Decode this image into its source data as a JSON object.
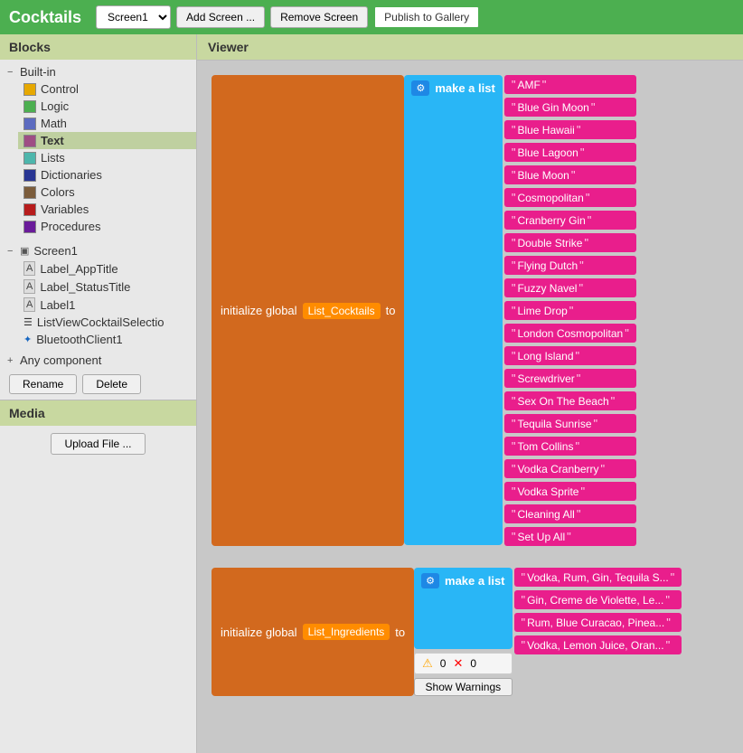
{
  "app": {
    "title": "Cocktails"
  },
  "topbar": {
    "screen_select": "Screen1",
    "add_screen_label": "Add Screen ...",
    "remove_screen_label": "Remove Screen",
    "publish_label": "Publish to Gallery"
  },
  "sidebar": {
    "blocks_header": "Blocks",
    "builtin_label": "Built-in",
    "builtin_items": [
      {
        "id": "control",
        "label": "Control",
        "color": "#e6a800"
      },
      {
        "id": "logic",
        "label": "Logic",
        "color": "#4caf50"
      },
      {
        "id": "math",
        "label": "Math",
        "color": "#5c6bc0"
      },
      {
        "id": "text",
        "label": "Text",
        "color": "#9e4e84",
        "selected": true
      },
      {
        "id": "lists",
        "label": "Lists",
        "color": "#4db6ac"
      },
      {
        "id": "dictionaries",
        "label": "Dictionaries",
        "color": "#283593"
      },
      {
        "id": "colors",
        "label": "Colors",
        "color": "#7b5c3b"
      },
      {
        "id": "variables",
        "label": "Variables",
        "color": "#b71c1c"
      },
      {
        "id": "procedures",
        "label": "Procedures",
        "color": "#6a1b9a"
      }
    ],
    "screen1_label": "Screen1",
    "screen1_children": [
      {
        "id": "label-apptitle",
        "label": "Label_AppTitle",
        "type": "label"
      },
      {
        "id": "label-statustitle",
        "label": "Label_StatusTitle",
        "type": "label"
      },
      {
        "id": "label1",
        "label": "Label1",
        "type": "label"
      },
      {
        "id": "listview",
        "label": "ListViewCocktailSelectio",
        "type": "list"
      },
      {
        "id": "bluetooth",
        "label": "BluetoothClient1",
        "type": "bt"
      }
    ],
    "any_component_label": "Any component",
    "rename_label": "Rename",
    "delete_label": "Delete",
    "media_header": "Media",
    "upload_label": "Upload File ..."
  },
  "viewer": {
    "header": "Viewer",
    "block1": {
      "init_text": "initialize global",
      "var_name": "List_Cocktails",
      "to_text": "to",
      "make_list_label": "make a list",
      "items": [
        "AMF",
        "Blue Gin Moon",
        "Blue Hawaii",
        "Blue Lagoon",
        "Blue Moon",
        "Cosmopolitan",
        "Cranberry Gin",
        "Double Strike",
        "Flying Dutch",
        "Fuzzy Navel",
        "Lime Drop",
        "London Cosmopolitan",
        "Long Island",
        "Screwdriver",
        "Sex On The Beach",
        "Tequila Sunrise",
        "Tom Collins",
        "Vodka Cranberry",
        "Vodka Sprite",
        "Cleaning All",
        "Set Up All"
      ]
    },
    "block2": {
      "init_text": "initialize global",
      "var_name": "List_Ingredients",
      "to_text": "to",
      "make_list_label": "make a list",
      "warnings_count": "0",
      "errors_count": "0",
      "show_warnings_label": "Show Warnings",
      "items": [
        "Vodka, Rum, Gin, Tequila S...",
        "Gin, Creme de Violette, Le...",
        "Rum, Blue Curacao, Pinea...",
        "Vodka, Lemon Juice, Oran..."
      ]
    }
  },
  "colors": {
    "control": "#e6a800",
    "logic": "#4caf50",
    "math": "#5c6bc0",
    "text": "#9e4e84",
    "lists": "#4db6ac",
    "dictionaries": "#283593",
    "colors_block": "#7b5c3b",
    "variables": "#b71c1c",
    "procedures": "#6a1b9a",
    "init_block": "#d2691e",
    "make_list": "#29b6f6",
    "string_item": "#e91e8c"
  }
}
